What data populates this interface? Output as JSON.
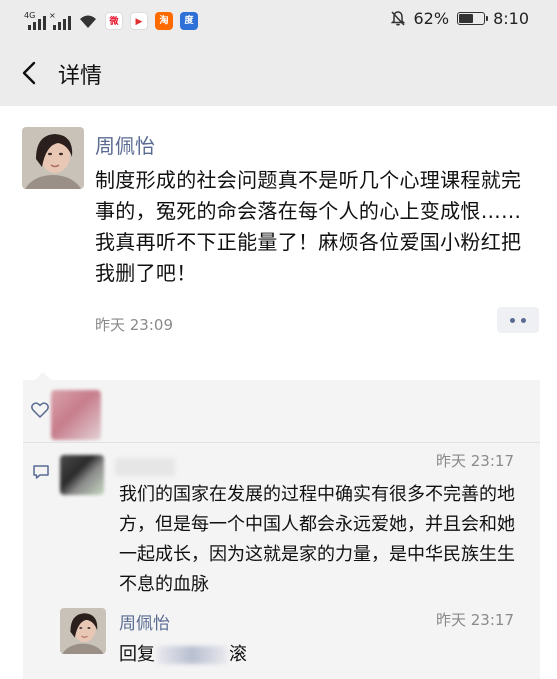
{
  "status_bar": {
    "network_label_1": "4G",
    "network_label_2": "×",
    "battery_percent": "62%",
    "battery_level": 0.62,
    "time": "8:10",
    "app_icons": [
      "weibo-icon",
      "video-app-icon",
      "taobao-icon",
      "baidu-icon"
    ]
  },
  "nav": {
    "title": "详情"
  },
  "post": {
    "author": "周佩怡",
    "text": "制度形成的社会问题真不是听几个心理课程就完事的，冤死的命会落在每个人的心上变成恨……我真再听不下正能量了！麻烦各位爱国小粉红把我删了吧！",
    "time": "昨天 23:09"
  },
  "comments": [
    {
      "time": "昨天 23:17",
      "text": "我们的国家在发展的过程中确实有很多不完善的地方，但是每一个中国人都会永远爱她，并且会和她一起成长，因为这就是家的力量，是中华民族生生不息的血脉"
    }
  ],
  "reply": {
    "author": "周佩怡",
    "time": "昨天 23:17",
    "prefix": "回复",
    "suffix": "滚"
  },
  "colors": {
    "bar_bg": "#ececec",
    "link_blue": "#5a6b92",
    "interaction_bg": "#f4f4f4",
    "muted_text": "#8a8a8a"
  }
}
